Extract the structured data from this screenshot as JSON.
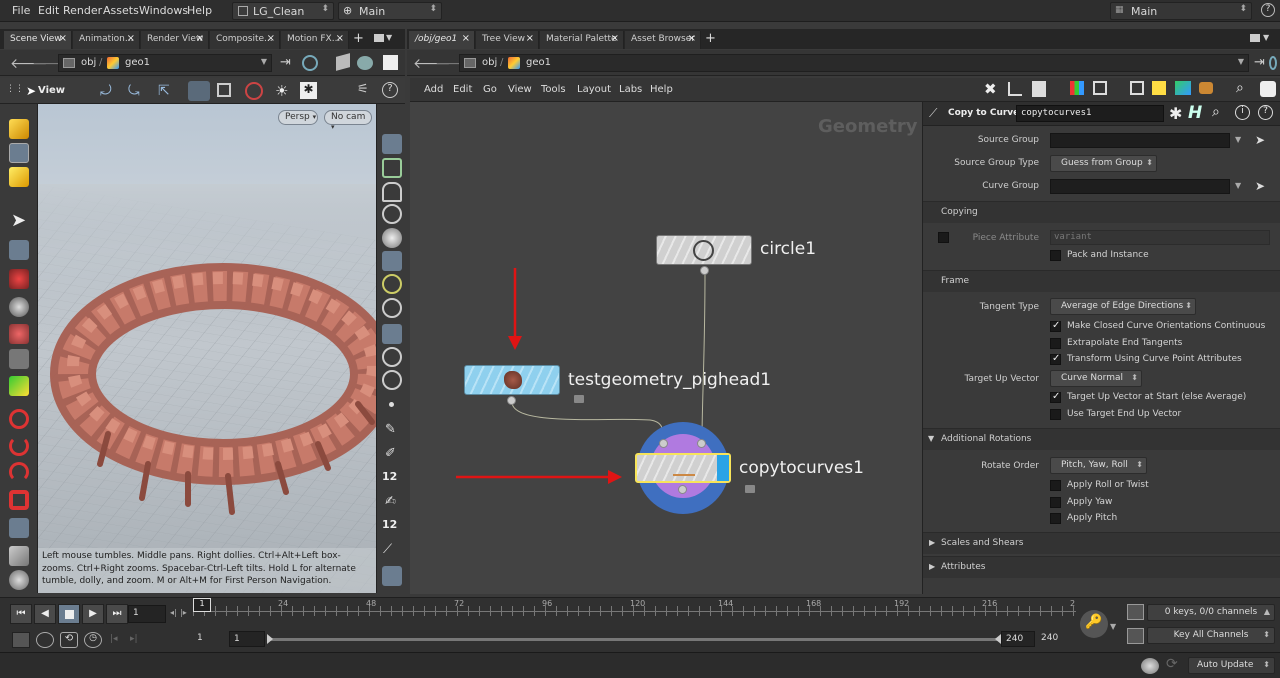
{
  "menubar": {
    "items": [
      "File",
      "Edit",
      "Render",
      "Assets",
      "Windows",
      "Help"
    ],
    "desktop": "LG_Clean",
    "context": "Main",
    "right_context": "Main"
  },
  "left_pane": {
    "tabs": [
      "Scene View",
      "Animation...",
      "Render View",
      "Composite...",
      "Motion FX..."
    ],
    "path": [
      "obj",
      "geo1"
    ],
    "toolbar_label": "View",
    "viewport": {
      "persp_label": "Persp",
      "cam_label": "No cam",
      "help_text": "Left mouse tumbles. Middle pans. Right dollies. Ctrl+Alt+Left box-zooms. Ctrl+Right zooms. Spacebar-Ctrl-Left tilts. Hold L for alternate tumble, dolly, and zoom.    M or Alt+M for First Person Navigation."
    },
    "right_tool_labels": [
      "12",
      "12"
    ]
  },
  "right_pane": {
    "tabs": [
      "/obj/geo1",
      "Tree View",
      "Material Palette",
      "Asset Browser"
    ],
    "path": [
      "obj",
      "geo1"
    ],
    "menu": [
      "Add",
      "Edit",
      "Go",
      "View",
      "Tools",
      "Layout",
      "Labs",
      "Help"
    ]
  },
  "network": {
    "context_label": "Geometry",
    "nodes": {
      "circle": "circle1",
      "testgeometry": "testgeometry_pighead1",
      "copytocurves": "copytocurves1"
    },
    "colors": {
      "selected_node": "#f7e45a",
      "test_node": "#8fd0ee",
      "blue_flag": "#2aa3e6",
      "arrow": "#e01414"
    }
  },
  "params": {
    "node_type": "Copy to Curves",
    "node_name": "copytocurves1",
    "source_group_label": "Source Group",
    "source_group_type_label": "Source Group Type",
    "source_group_type_value": "Guess from Group",
    "curve_group_label": "Curve Group",
    "section_copying": "Copying",
    "piece_attribute_label": "Piece Attribute",
    "piece_attribute_value": "variant",
    "pack_instance_label": "Pack and Instance",
    "section_frame": "Frame",
    "tangent_type_label": "Tangent Type",
    "tangent_type_value": "Average of Edge Directions",
    "make_closed_label": "Make Closed Curve Orientations Continuous",
    "extrapolate_label": "Extrapolate End Tangents",
    "transform_label": "Transform Using Curve Point Attributes",
    "target_up_label": "Target Up Vector",
    "target_up_value": "Curve Normal",
    "target_up_start_label": "Target Up Vector at Start (else Average)",
    "use_target_end_label": "Use Target End Up Vector",
    "section_additional": "Additional Rotations",
    "rotate_order_label": "Rotate Order",
    "rotate_order_value": "Pitch, Yaw, Roll",
    "apply_roll_label": "Apply Roll or Twist",
    "apply_yaw_label": "Apply Yaw",
    "apply_pitch_label": "Apply Pitch",
    "section_scales": "Scales and Shears",
    "section_attributes": "Attributes"
  },
  "timeline": {
    "current_frame": "1",
    "frame_marker": "1",
    "ticks": [
      "24",
      "48",
      "72",
      "96",
      "120",
      "144",
      "168",
      "192",
      "216",
      "2"
    ],
    "range_start": "1",
    "range_start2": "1",
    "range_end": "240",
    "range_end2": "240",
    "keys_label": "0 keys, 0/0 channels",
    "key_all_label": "Key All Channels"
  },
  "status": {
    "auto_update": "Auto Update"
  }
}
